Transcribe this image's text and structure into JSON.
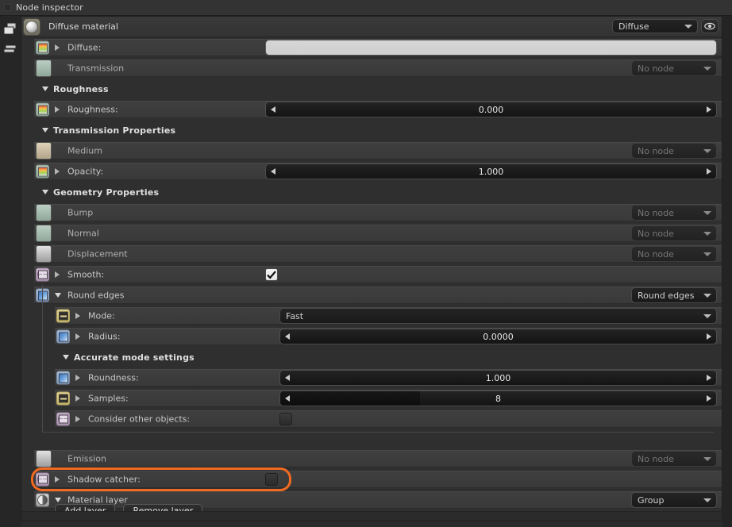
{
  "window": {
    "title": "Node inspector"
  },
  "rail": {
    "buttons": [
      {
        "name": "stacked-windows-icon",
        "tooltip": "Windows"
      },
      {
        "name": "list-lines-icon",
        "tooltip": "List"
      }
    ]
  },
  "header": {
    "material_name": "Diffuse material",
    "type_dropdown": "Diffuse",
    "visibility_icon": "eye-icon"
  },
  "rows": [
    {
      "id": "diffuse",
      "label": "Diffuse:",
      "indent": 0,
      "icon": "texture-node-icon",
      "icon_kind": "tex",
      "expander": "right",
      "widget": "textfield",
      "value": ""
    },
    {
      "id": "transmission",
      "label": "Transmission",
      "indent": 0,
      "icon": "green-swatch",
      "icon_kind": "sw-green",
      "expander": "none",
      "widget": "combo",
      "value": "No node",
      "disabled": true
    },
    {
      "id": "sec-roughness",
      "label": "Roughness",
      "indent": 0,
      "kind": "section",
      "expander": "down"
    },
    {
      "id": "roughness",
      "label": "Roughness:",
      "indent": 0,
      "icon": "texture-node-icon",
      "icon_kind": "tex",
      "expander": "right",
      "widget": "slider",
      "value": "0.000",
      "fill_pct": 0
    },
    {
      "id": "sec-transmission-properties",
      "label": "Transmission Properties",
      "indent": 0,
      "kind": "section",
      "expander": "down"
    },
    {
      "id": "medium",
      "label": "Medium",
      "indent": 0,
      "icon": "tan-swatch",
      "icon_kind": "sw-tan",
      "expander": "none",
      "widget": "combo",
      "value": "No node",
      "disabled": true
    },
    {
      "id": "opacity",
      "label": "Opacity:",
      "indent": 0,
      "icon": "texture-node-icon",
      "icon_kind": "tex",
      "expander": "right",
      "widget": "slider",
      "value": "1.000",
      "fill_pct": 0
    },
    {
      "id": "sec-geometry-properties",
      "label": "Geometry Properties",
      "indent": 0,
      "kind": "section",
      "expander": "down"
    },
    {
      "id": "bump",
      "label": "Bump",
      "indent": 0,
      "icon": "green-swatch",
      "icon_kind": "sw-green",
      "expander": "none",
      "widget": "combo",
      "value": "No node",
      "disabled": true
    },
    {
      "id": "normal",
      "label": "Normal",
      "indent": 0,
      "icon": "green-swatch",
      "icon_kind": "sw-green",
      "expander": "none",
      "widget": "combo",
      "value": "No node",
      "disabled": true
    },
    {
      "id": "displacement",
      "label": "Displacement",
      "indent": 0,
      "icon": "grey-swatch",
      "icon_kind": "sw-grey",
      "expander": "none",
      "widget": "combo",
      "value": "No node",
      "disabled": true
    },
    {
      "id": "smooth",
      "label": "Smooth:",
      "indent": 0,
      "icon": "bool-node-icon",
      "icon_kind": "bool",
      "expander": "right",
      "widget": "checkbox",
      "checked": true
    },
    {
      "id": "round-edges",
      "label": "Round edges",
      "indent": 0,
      "icon": "round-edges-node-icon",
      "icon_kind": "blue",
      "expander": "down",
      "widget": "combo",
      "value": "Round edges",
      "disabled": false
    },
    {
      "id": "mode",
      "label": "Mode:",
      "indent": 1,
      "icon": "enum-node-icon",
      "icon_kind": "int",
      "expander": "right",
      "widget": "combo-wide",
      "value": "Fast",
      "disabled": false
    },
    {
      "id": "radius",
      "label": "Radius:",
      "indent": 1,
      "icon": "float-node-icon",
      "icon_kind": "blue",
      "expander": "right",
      "widget": "slider",
      "value": "0.0000",
      "fill_pct": 0
    },
    {
      "id": "sec-accurate-mode-settings",
      "label": "Accurate mode settings",
      "indent": 1,
      "kind": "section",
      "expander": "down"
    },
    {
      "id": "roundness",
      "label": "Roundness:",
      "indent": 1,
      "icon": "float-node-icon",
      "icon_kind": "blue",
      "expander": "right",
      "widget": "slider",
      "value": "1.000",
      "fill_pct": 0
    },
    {
      "id": "samples",
      "label": "Samples:",
      "indent": 1,
      "icon": "int-node-icon",
      "icon_kind": "int",
      "expander": "right",
      "widget": "slider",
      "value": "8",
      "fill_pct": 32
    },
    {
      "id": "consider-other-objects",
      "label": "Consider other objects:",
      "indent": 1,
      "icon": "bool-node-icon",
      "icon_kind": "bool",
      "expander": "right",
      "widget": "checkbox",
      "checked": false
    },
    {
      "id": "spacer-1",
      "kind": "spacer"
    },
    {
      "id": "emission",
      "label": "Emission",
      "indent": 0,
      "icon": "grey-swatch",
      "icon_kind": "sw-grey",
      "expander": "none",
      "widget": "combo",
      "value": "No node",
      "disabled": true
    },
    {
      "id": "shadow-catcher",
      "label": "Shadow catcher:",
      "indent": 0,
      "icon": "bool-node-icon",
      "icon_kind": "bool",
      "expander": "right",
      "widget": "checkbox",
      "checked": false,
      "highlighted": true
    },
    {
      "id": "material-layer",
      "label": "Material layer",
      "indent": 0,
      "icon": "material-layer-node-icon",
      "icon_kind": "grad",
      "expander": "down",
      "widget": "combo",
      "value": "Group",
      "disabled": false
    }
  ],
  "footer": {
    "add_layer_label": "Add layer",
    "remove_layer_label": "Remove layer"
  },
  "colors": {
    "highlight": "#f26a21",
    "panel_bg": "#2f2f2f",
    "row_bg": "#3a3a3a",
    "text": "#c8c8c8"
  }
}
